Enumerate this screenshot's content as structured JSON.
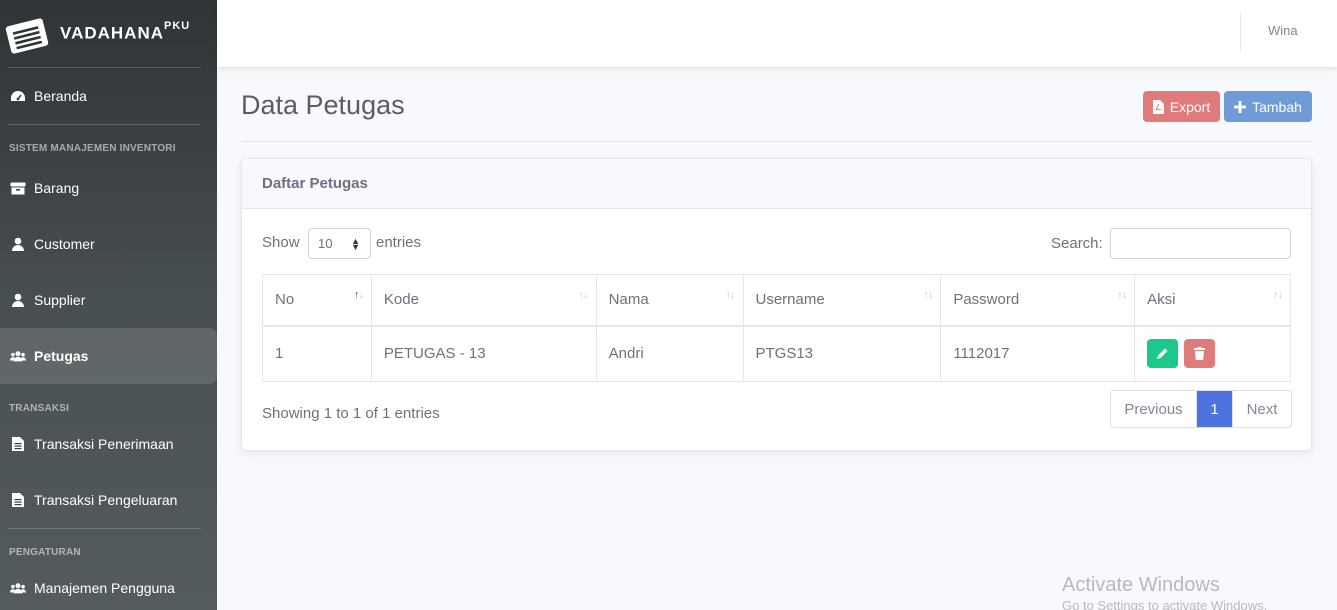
{
  "sidebar": {
    "brand": "VADAHANA",
    "brand_sup": "PKU",
    "items": {
      "beranda": "Beranda",
      "heading_sistem": "SISTEM MANAJEMEN INVENTORI",
      "barang": "Barang",
      "customer": "Customer",
      "supplier": "Supplier",
      "petugas": "Petugas",
      "heading_transaksi": "TRANSAKSI",
      "penerimaan": "Transaksi Penerimaan",
      "pengeluaran": "Transaksi Pengeluaran",
      "heading_pengaturan": "PENGATURAN",
      "pengguna": "Manajemen Pengguna"
    },
    "active": "petugas"
  },
  "topbar": {
    "user": "Wina"
  },
  "page": {
    "title": "Data Petugas",
    "export_label": "Export",
    "tambah_label": "Tambah"
  },
  "card": {
    "title": "Daftar Petugas",
    "show_label": "Show",
    "entries_value": "10",
    "entries_label": "entries",
    "search_label": "Search:",
    "search_value": "",
    "columns": [
      "No",
      "Kode",
      "Nama",
      "Username",
      "Password",
      "Aksi"
    ],
    "rows": [
      [
        "1",
        "PETUGAS - 13",
        "Andri",
        "PTGS13",
        "1112017"
      ]
    ],
    "info": "Showing 1 to 1 of 1 entries",
    "pager": {
      "prev": "Previous",
      "page": "1",
      "next": "Next"
    }
  },
  "watermark": {
    "line1": "Activate Windows",
    "line2": "Go to Settings to activate Windows."
  },
  "colors": {
    "primary": "#4e73df",
    "success": "#1cc88a",
    "danger": "#e07b7b",
    "info": "#6f9bd6"
  }
}
